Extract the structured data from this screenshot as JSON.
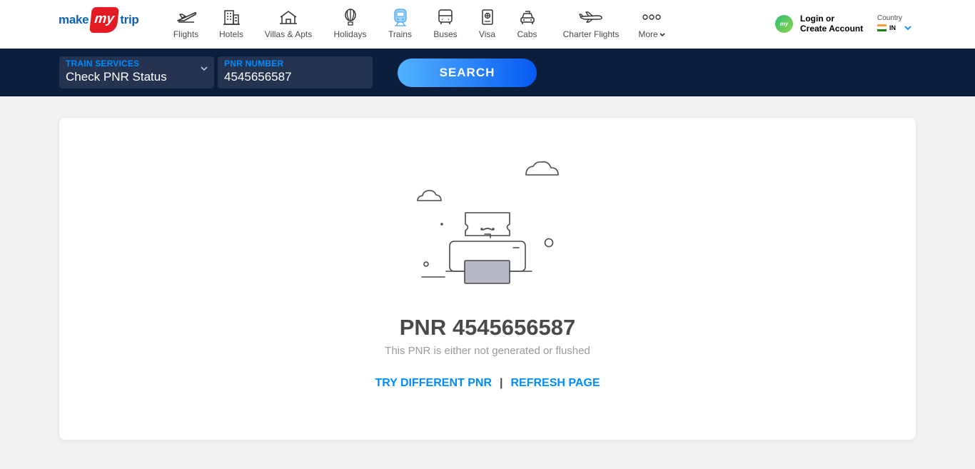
{
  "header": {
    "logo": {
      "make": "make",
      "my": "my",
      "trip": "trip"
    },
    "nav": [
      {
        "label": "Flights",
        "icon": "flight-icon"
      },
      {
        "label": "Hotels",
        "icon": "hotel-icon"
      },
      {
        "label": "Villas & Apts",
        "icon": "villa-icon"
      },
      {
        "label": "Holidays",
        "icon": "holiday-icon"
      },
      {
        "label": "Trains",
        "icon": "train-icon",
        "active": true
      },
      {
        "label": "Buses",
        "icon": "bus-icon"
      },
      {
        "label": "Visa",
        "icon": "visa-icon"
      },
      {
        "label": "Cabs",
        "icon": "cab-icon"
      },
      {
        "label": "Charter Flights",
        "icon": "charter-flight-icon"
      },
      {
        "label": "More",
        "icon": "more-icon"
      }
    ],
    "login": {
      "avatar_text": "my",
      "line1": "Login or",
      "line2": "Create Account"
    },
    "country": {
      "label": "Country",
      "code": "IN"
    }
  },
  "search": {
    "service": {
      "label": "TRAIN SERVICES",
      "value": "Check PNR Status"
    },
    "pnr": {
      "label": "PNR NUMBER",
      "value": "4545656587"
    },
    "button": "SEARCH"
  },
  "result": {
    "title": "PNR 4545656587",
    "subtitle": "This PNR is either not generated or flushed",
    "try_different": "TRY DIFFERENT PNR",
    "separator": "|",
    "refresh": "REFRESH PAGE"
  },
  "colors": {
    "brand_blue": "#0a62b7",
    "brand_red": "#e41b23",
    "link_blue": "#008cff",
    "search_bg": "#0b1f3d",
    "field_bg": "#233350"
  }
}
